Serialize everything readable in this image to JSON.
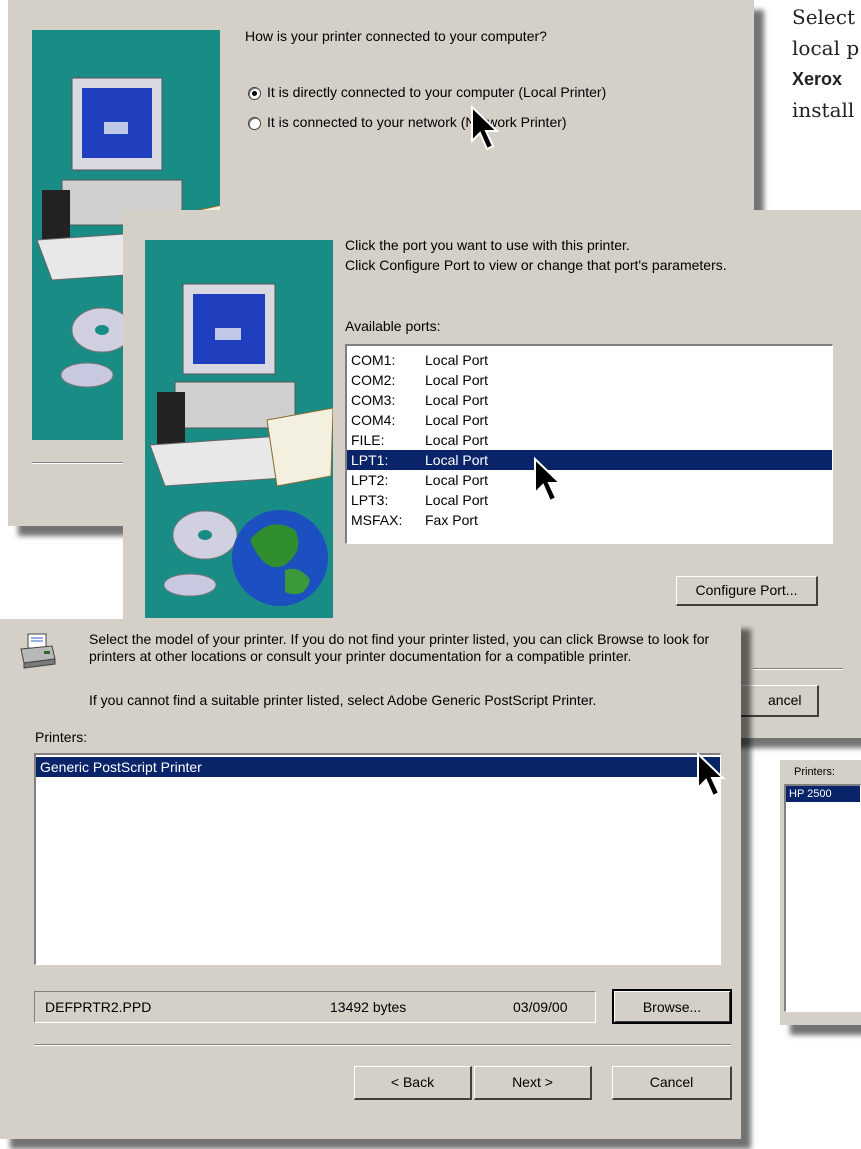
{
  "caption": {
    "line1": "Select",
    "line2": "local p",
    "line3_bold": "Xerox",
    "line4": "install"
  },
  "dialog_connection": {
    "question": "How is your printer connected to your computer?",
    "options": [
      {
        "label": "It is directly connected to your computer (Local Printer)",
        "selected": true
      },
      {
        "label": "It is connected to your network (Network Printer)",
        "selected": false
      }
    ]
  },
  "dialog_port": {
    "instruction_1": "Click the port you want to use with this printer.",
    "instruction_2": "Click Configure Port to view or change that port's parameters.",
    "ports_label": "Available ports:",
    "ports": [
      {
        "port": "COM1:",
        "desc": "Local Port"
      },
      {
        "port": "COM2:",
        "desc": "Local Port"
      },
      {
        "port": "COM3:",
        "desc": "Local Port"
      },
      {
        "port": "COM4:",
        "desc": "Local Port"
      },
      {
        "port": "FILE:",
        "desc": "Local Port"
      },
      {
        "port": "LPT1:",
        "desc": "Local Port",
        "selected": true
      },
      {
        "port": "LPT2:",
        "desc": "Local Port"
      },
      {
        "port": "LPT3:",
        "desc": "Local Port"
      },
      {
        "port": "MSFAX:",
        "desc": "Fax Port"
      }
    ],
    "configure_button": "Configure Port...",
    "cancel_partial": "ancel"
  },
  "dialog_model": {
    "instruction": "Select the model of your printer. If you do not find your printer listed, you can click Browse to look for printers at other locations or consult your printer documentation for a compatible printer.",
    "fallback": "If you cannot find a suitable printer listed, select Adobe Generic PostScript Printer.",
    "printers_label": "Printers:",
    "printers": [
      {
        "name": "Generic PostScript Printer",
        "selected": true
      }
    ],
    "file": {
      "name": "DEFPRTR2.PPD",
      "size": "13492 bytes",
      "date": "03/09/00"
    },
    "browse_button": "Browse...",
    "back_button": "< Back",
    "next_button": "Next >",
    "cancel_button": "Cancel"
  },
  "dialog_partial": {
    "printers_label": "Printers:",
    "selected_printer": "HP 2500"
  },
  "colors": {
    "dialog": "#d4d0c8",
    "selection": "#0a246a",
    "teal_panel": "#1a8c86"
  }
}
